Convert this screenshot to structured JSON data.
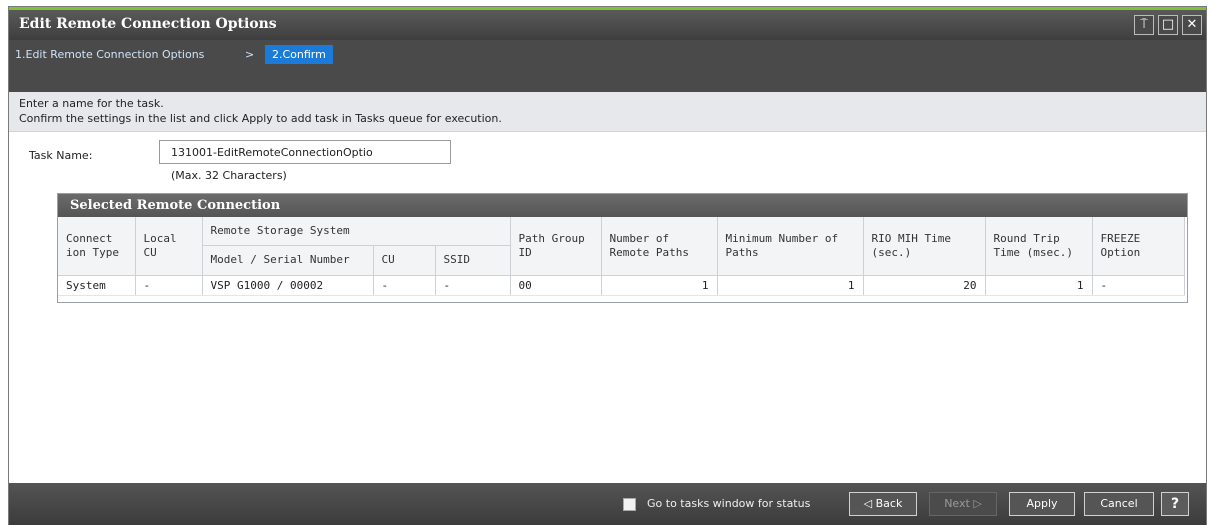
{
  "window": {
    "title": "Edit Remote Connection Options",
    "controls": {
      "pin": "⍑",
      "maximize": "□",
      "close": "✕"
    }
  },
  "wizard": {
    "step1": "1.Edit Remote Connection Options",
    "separator": ">",
    "step2": "2.Confirm"
  },
  "instructions": {
    "line1": "Enter a name for the task.",
    "line2": "Confirm the settings in the list and click Apply to add task in Tasks queue for execution."
  },
  "task": {
    "label": "Task Name:",
    "value": "131001-EditRemoteConnectionOptio",
    "hint": "(Max. 32 Characters)"
  },
  "table": {
    "title": "Selected Remote Connection",
    "headers": {
      "connection_type": "Connect ion Type",
      "local_cu": "Local CU",
      "remote_storage": "Remote Storage System",
      "model_serial": "Model / Serial Number",
      "cu": "CU",
      "ssid": "SSID",
      "path_group": "Path Group ID",
      "num_remote_paths": "Number of Remote Paths",
      "min_paths": "Minimum Number of Paths",
      "rio_mih": "RIO MIH Time (sec.)",
      "round_trip": "Round Trip Time (msec.)",
      "freeze": "FREEZE Option"
    },
    "rows": [
      {
        "connection_type": "System",
        "local_cu": "-",
        "model_serial": "VSP G1000 / 00002",
        "cu": "-",
        "ssid": "-",
        "path_group": "00",
        "num_remote_paths": "1",
        "min_paths": "1",
        "rio_mih": "20",
        "round_trip": "1",
        "freeze": "-"
      }
    ]
  },
  "footer": {
    "go_to_tasks_label": "Go to tasks window for status",
    "back": "◁ Back",
    "next": "Next ▷",
    "apply": "Apply",
    "cancel": "Cancel",
    "help": "?"
  }
}
